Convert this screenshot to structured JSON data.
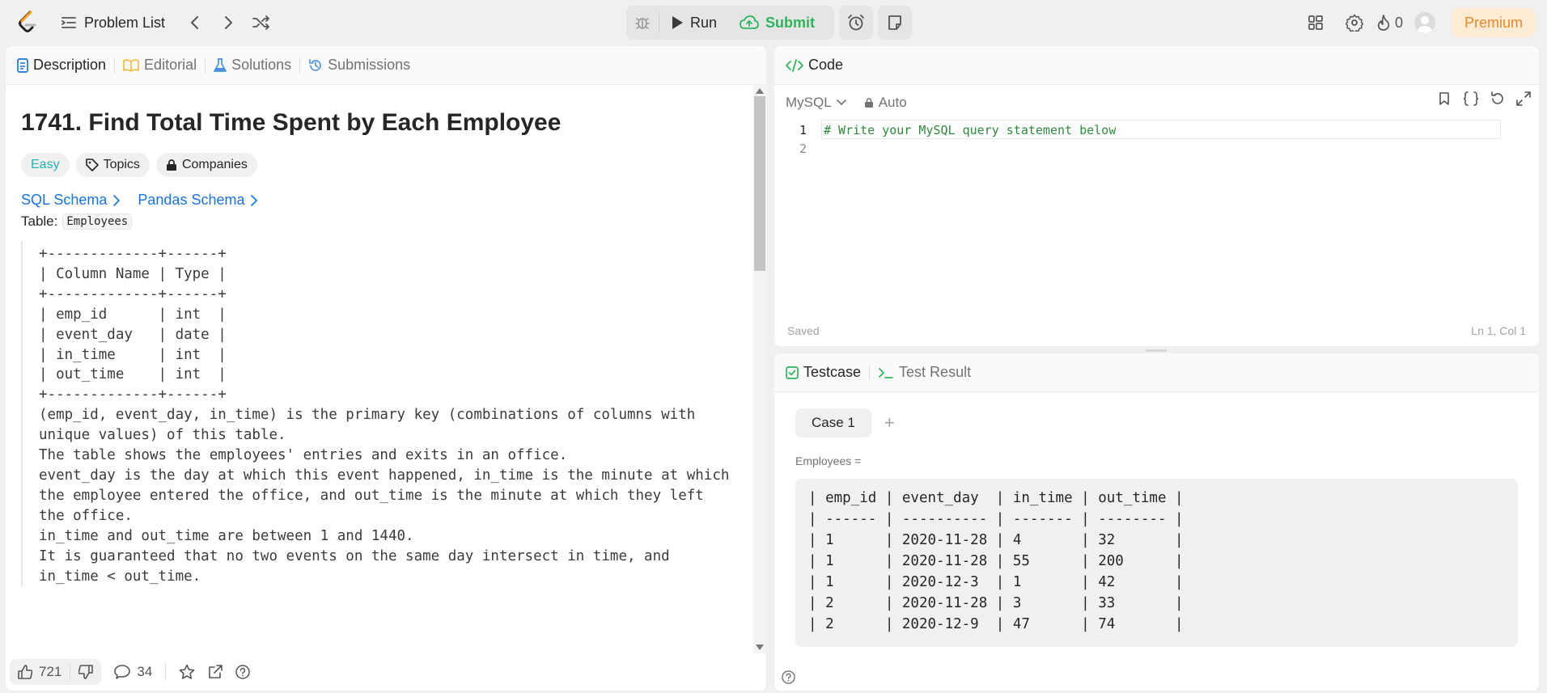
{
  "topbar": {
    "problem_list": "Problem List",
    "run": "Run",
    "submit": "Submit",
    "streak_count": "0",
    "premium": "Premium",
    "icons": [
      "logo-icon",
      "list-icon",
      "chevron-left-icon",
      "chevron-right-icon",
      "shuffle-icon",
      "bug-icon",
      "play-icon",
      "cloud-upload-icon",
      "alarm-icon",
      "note-icon",
      "layout-icon",
      "gear-icon",
      "flame-icon",
      "avatar"
    ]
  },
  "left_tabs": {
    "description": "Description",
    "editorial": "Editorial",
    "solutions": "Solutions",
    "submissions": "Submissions"
  },
  "problem": {
    "title": "1741. Find Total Time Spent by Each Employee",
    "difficulty": "Easy",
    "topics": "Topics",
    "companies": "Companies",
    "sql_schema": "SQL Schema",
    "pandas_schema": "Pandas Schema",
    "table_label": "Table:",
    "table_name": "Employees",
    "schema_text": "+-------------+------+\n| Column Name | Type |\n+-------------+------+\n| emp_id      | int  |\n| event_day   | date |\n| in_time     | int  |\n| out_time    | int  |\n+-------------+------+\n(emp_id, event_day, in_time) is the primary key (combinations of columns with\nunique values) of this table.\nThe table shows the employees' entries and exits in an office.\nevent_day is the day at which this event happened, in_time is the minute at which\nthe employee entered the office, and out_time is the minute at which they left\nthe office.\nin_time and out_time are between 1 and 1440.\nIt is guaranteed that no two events on the same day intersect in time, and\nin_time < out_time."
  },
  "footer": {
    "likes": "721",
    "comments": "34"
  },
  "code_panel": {
    "title": "Code",
    "language": "MySQL",
    "auto": "Auto",
    "line_numbers": [
      "1",
      "2"
    ],
    "line1": "# Write your MySQL query statement below",
    "saved": "Saved",
    "cursor": "Ln 1, Col 1"
  },
  "test_panel": {
    "testcase": "Testcase",
    "test_result": "Test Result",
    "case1": "Case 1",
    "plus": "+",
    "var_label": "Employees =",
    "input": "| emp_id | event_day  | in_time | out_time |\n| ------ | ---------- | ------- | -------- |\n| 1      | 2020-11-28 | 4       | 32       |\n| 1      | 2020-11-28 | 55      | 200      |\n| 1      | 2020-12-3  | 1       | 42       |\n| 2      | 2020-11-28 | 3       | 33       |\n| 2      | 2020-12-9  | 47      | 74       |"
  },
  "colors": {
    "accent_green": "#2db55d",
    "easy": "#1cb8b8",
    "link_blue": "#1a73e8",
    "premium_text": "#e98a2b",
    "premium_bg": "#fdebd3",
    "logo_orange": "#ffa116"
  }
}
